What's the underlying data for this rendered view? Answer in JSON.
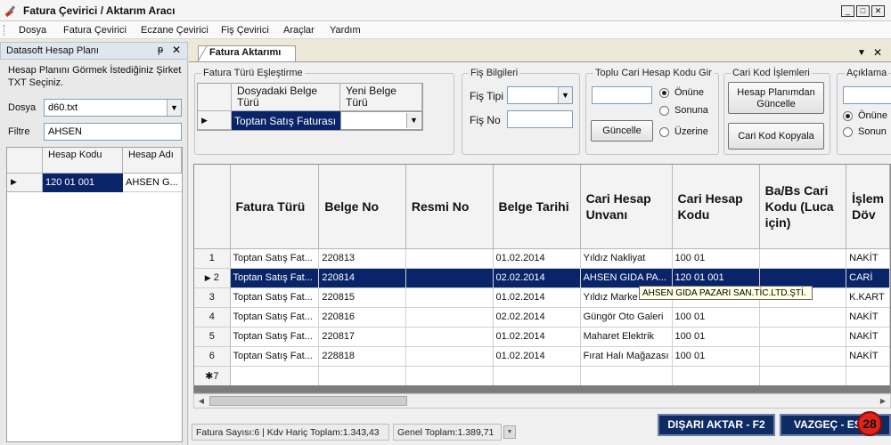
{
  "window": {
    "title": "Fatura Çevirici / Aktarım Aracı"
  },
  "menu": [
    "Dosya",
    "Fatura Çevirici",
    "Eczane Çevirici",
    "Fiş Çevirici",
    "Araçlar",
    "Yardım"
  ],
  "left_panel": {
    "title": "Datasoft Hesap Planı",
    "pin": "ᵽ",
    "close": "✕",
    "instruction": "Hesap Planını Görmek İstediğiniz Şirket TXT Seçiniz.",
    "file_label": "Dosya",
    "file_value": "d60.txt",
    "filter_label": "Filtre",
    "filter_value": "AHSEN",
    "grid": {
      "col1": "Hesap Kodu",
      "col2": "Hesap Adı",
      "rows": [
        {
          "code": "120 01 001",
          "name": "AHSEN G..."
        }
      ]
    }
  },
  "tab": {
    "label": "Fatura Aktarımı"
  },
  "mapping": {
    "title": "Fatura Türü Eşleştirme",
    "col1": "Dosyadaki Belge Türü",
    "col2": "Yeni Belge Türü",
    "row_value": "Toptan Satış Faturası"
  },
  "fis": {
    "title": "Fiş Bilgileri",
    "tipi_label": "Fiş Tipi",
    "no_label": "Fiş No"
  },
  "toplu": {
    "title": "Toplu Cari Hesap Kodu Gir",
    "opt1": "Önüne",
    "opt2": "Sonuna",
    "opt3": "Üzerine",
    "button": "Güncelle"
  },
  "cari": {
    "title": "Cari Kod İşlemleri",
    "button1": "Hesap Planımdan Güncelle",
    "button2": "Cari Kod Kopyala"
  },
  "aciklama": {
    "title": "Açıklama",
    "opt1": "Önüne",
    "opt2": "Sonun"
  },
  "table": {
    "headers": [
      "Fatura Türü",
      "Belge No",
      "Resmi No",
      "Belge Tarihi",
      "Cari Hesap Unvanı",
      "Cari Hesap Kodu",
      "Ba/Bs Cari Kodu (Luca için)",
      "İşlem Döv"
    ],
    "rows": [
      {
        "n": "1",
        "tur": "Toptan Satış Fat...",
        "belge": "220813",
        "resmi": "",
        "tarih": "01.02.2014",
        "unvan": "Yıldız Nakliyat",
        "kod": "100 01",
        "babs": "",
        "islem": "NAKİT"
      },
      {
        "n": "",
        "tur": "Toptan Satış Fat...",
        "belge": "220814",
        "resmi": "",
        "tarih": "02.02.2014",
        "unvan": "AHSEN GIDA PA...",
        "kod": "120 01 001",
        "babs": "",
        "islem": "CARİ"
      },
      {
        "n": "3",
        "tur": "Toptan Satış Fat...",
        "belge": "220815",
        "resmi": "",
        "tarih": "01.02.2014",
        "unvan": "Yıldız Marke",
        "kod": "",
        "babs": "",
        "islem": "K.KART"
      },
      {
        "n": "4",
        "tur": "Toptan Satış Fat...",
        "belge": "220816",
        "resmi": "",
        "tarih": "02.02.2014",
        "unvan": "Güngör Oto Galeri",
        "kod": "100 01",
        "babs": "",
        "islem": "NAKİT"
      },
      {
        "n": "5",
        "tur": "Toptan Satış Fat...",
        "belge": "220817",
        "resmi": "",
        "tarih": "01.02.2014",
        "unvan": "Maharet Elektrik",
        "kod": "100 01",
        "babs": "",
        "islem": "NAKİT"
      },
      {
        "n": "6",
        "tur": "Toptan Satış Fat...",
        "belge": "228818",
        "resmi": "",
        "tarih": "01.02.2014",
        "unvan": "Fırat Halı Mağazası",
        "kod": "100 01",
        "babs": "",
        "islem": "NAKİT"
      }
    ],
    "new_row_label": "7",
    "selected_row_marker": "2"
  },
  "tooltip": "AHSEN GIDA PAZARI SAN.TİC.LTD.ŞTİ.",
  "status": {
    "count": "Fatura Sayısı:6",
    "kdv": "Kdv Hariç Toplam:1.343,43",
    "genel": "Genel Toplam:1.389,71"
  },
  "buttons": {
    "export": "DIŞARI AKTAR - F2",
    "cancel": "VAZGEÇ - ES"
  },
  "badge": "28",
  "colors": {
    "selection": "#0a246a",
    "action_button": "#0f2b63",
    "badge": "#e2231a",
    "tooltip_bg": "#ffffe1"
  }
}
